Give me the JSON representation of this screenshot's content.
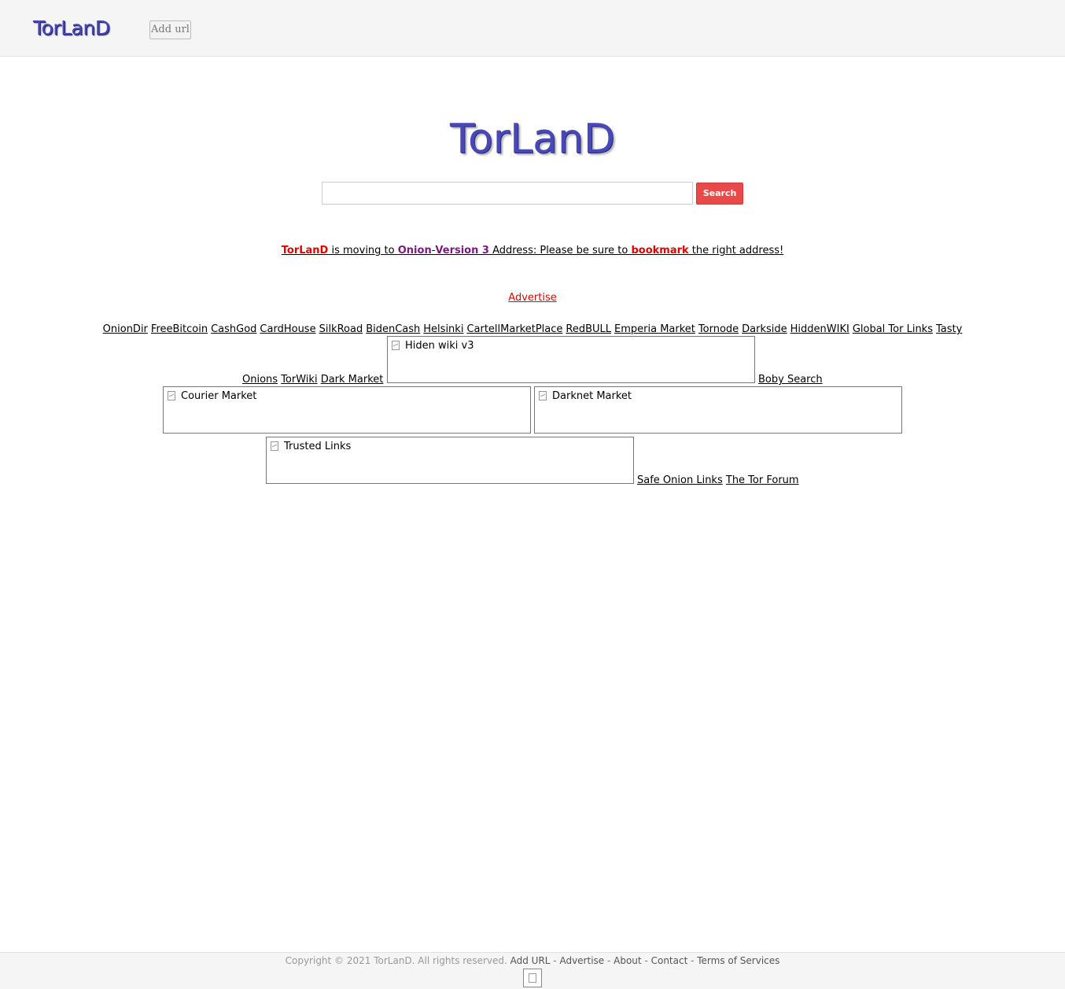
{
  "header": {
    "logo": "TorLanD",
    "add_url": "Add url"
  },
  "main": {
    "logo": "TorLanD",
    "search": {
      "value": "",
      "button": "Search"
    },
    "notice": {
      "brand": "TorLanD",
      "t1": " is moving to ",
      "onion": "Onion",
      "dash": "-",
      "version": "Version 3",
      "t2": " Address: Please be sure to ",
      "bookmark": "bookmark",
      "t3": " the right address!"
    },
    "advertise": "Advertise",
    "links_row1": [
      "OnionDir",
      "FreeBitcoin",
      "CashGod",
      "CardHouse",
      "SilkRoad",
      "BidenCash",
      "Helsinki",
      "CartellMarketPlace",
      "RedBULL",
      "Emperia Market",
      "Tornode",
      "Darkside",
      "HiddenWIKI",
      "Global Tor Links",
      "Tasty"
    ],
    "links_row2_left": [
      "Onions",
      "TorWiki",
      "Dark Market"
    ],
    "banner_hidenwiki": "Hiden wiki v3",
    "link_boby": "Boby Search",
    "banner_courier": "Courier Market",
    "banner_darknet": "Darknet Market",
    "banner_trusted": "Trusted Links",
    "links_row4_right": [
      "Safe Onion Links",
      "The Tor Forum"
    ]
  },
  "footer": {
    "copyright": "Copyright © 2021 TorLanD. All rights reserved.",
    "links": [
      "Add URL",
      "Advertise",
      "About",
      "Contact",
      "Terms of Services"
    ],
    "sep": " - "
  }
}
